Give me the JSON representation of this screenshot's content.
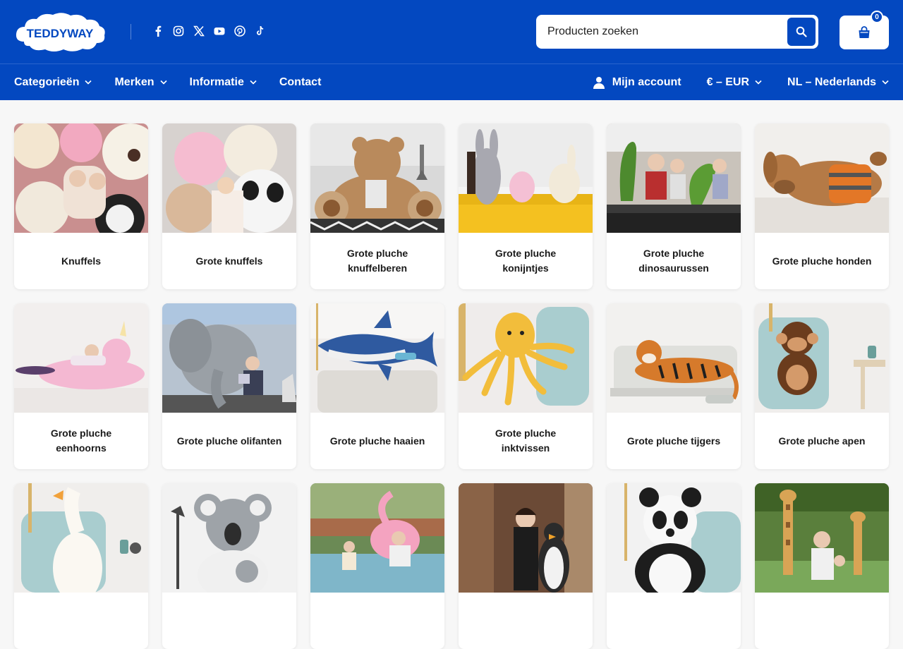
{
  "brand": {
    "name": "TEDDYWAY",
    "primary_color": "#0348c0"
  },
  "socials": [
    "facebook-icon",
    "instagram-icon",
    "x-icon",
    "youtube-icon",
    "pinterest-icon",
    "tiktok-icon"
  ],
  "search": {
    "placeholder": "Producten zoeken"
  },
  "cart": {
    "count": "0"
  },
  "nav": {
    "categories": "Categorieën",
    "brands": "Merken",
    "info": "Informatie",
    "contact": "Contact",
    "account": "Mijn account",
    "currency": "€ – EUR",
    "language": "NL – Nederlands"
  },
  "categories": [
    {
      "label": "Knuffels",
      "theme": "pile"
    },
    {
      "label": "Grote knuffels",
      "theme": "pile2"
    },
    {
      "label": "Grote pluche knuffelberen",
      "theme": "bear"
    },
    {
      "label": "Grote pluche konijntjes",
      "theme": "bunny"
    },
    {
      "label": "Grote pluche dinosaurussen",
      "theme": "dino"
    },
    {
      "label": "Grote pluche honden",
      "theme": "dog"
    },
    {
      "label": "Grote pluche eenhoorns",
      "theme": "unicorn"
    },
    {
      "label": "Grote pluche olifanten",
      "theme": "elephant"
    },
    {
      "label": "Grote pluche haaien",
      "theme": "shark"
    },
    {
      "label": "Grote pluche inktvissen",
      "theme": "octopus"
    },
    {
      "label": "Grote pluche tijgers",
      "theme": "tiger"
    },
    {
      "label": "Grote pluche apen",
      "theme": "monkey"
    },
    {
      "label": "",
      "theme": "goose"
    },
    {
      "label": "",
      "theme": "koala"
    },
    {
      "label": "",
      "theme": "flamingo"
    },
    {
      "label": "",
      "theme": "penguin"
    },
    {
      "label": "",
      "theme": "panda"
    },
    {
      "label": "",
      "theme": "giraffe"
    }
  ]
}
